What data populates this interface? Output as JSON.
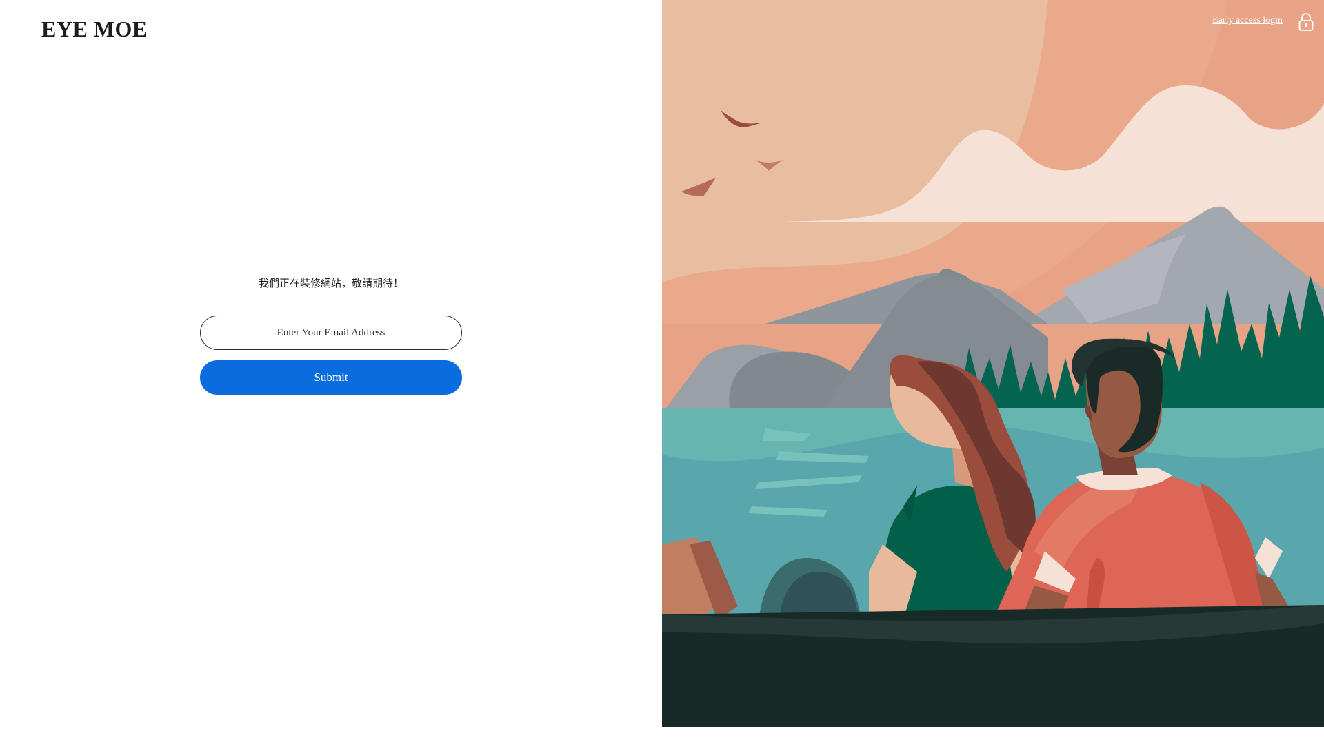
{
  "brand": {
    "name": "EYE MOE"
  },
  "main": {
    "tagline": "我們正在裝修網站，敬請期待！",
    "email": {
      "placeholder": "Enter Your Email Address",
      "value": ""
    },
    "submit_label": "Submit"
  },
  "header_right": {
    "login_label": "Early access login",
    "lock_icon": "lock-icon"
  },
  "colors": {
    "accent": "#0a6ddf",
    "sky": "#e9bfa0",
    "lake": "#5fa9ad",
    "boat": "#172a27"
  }
}
